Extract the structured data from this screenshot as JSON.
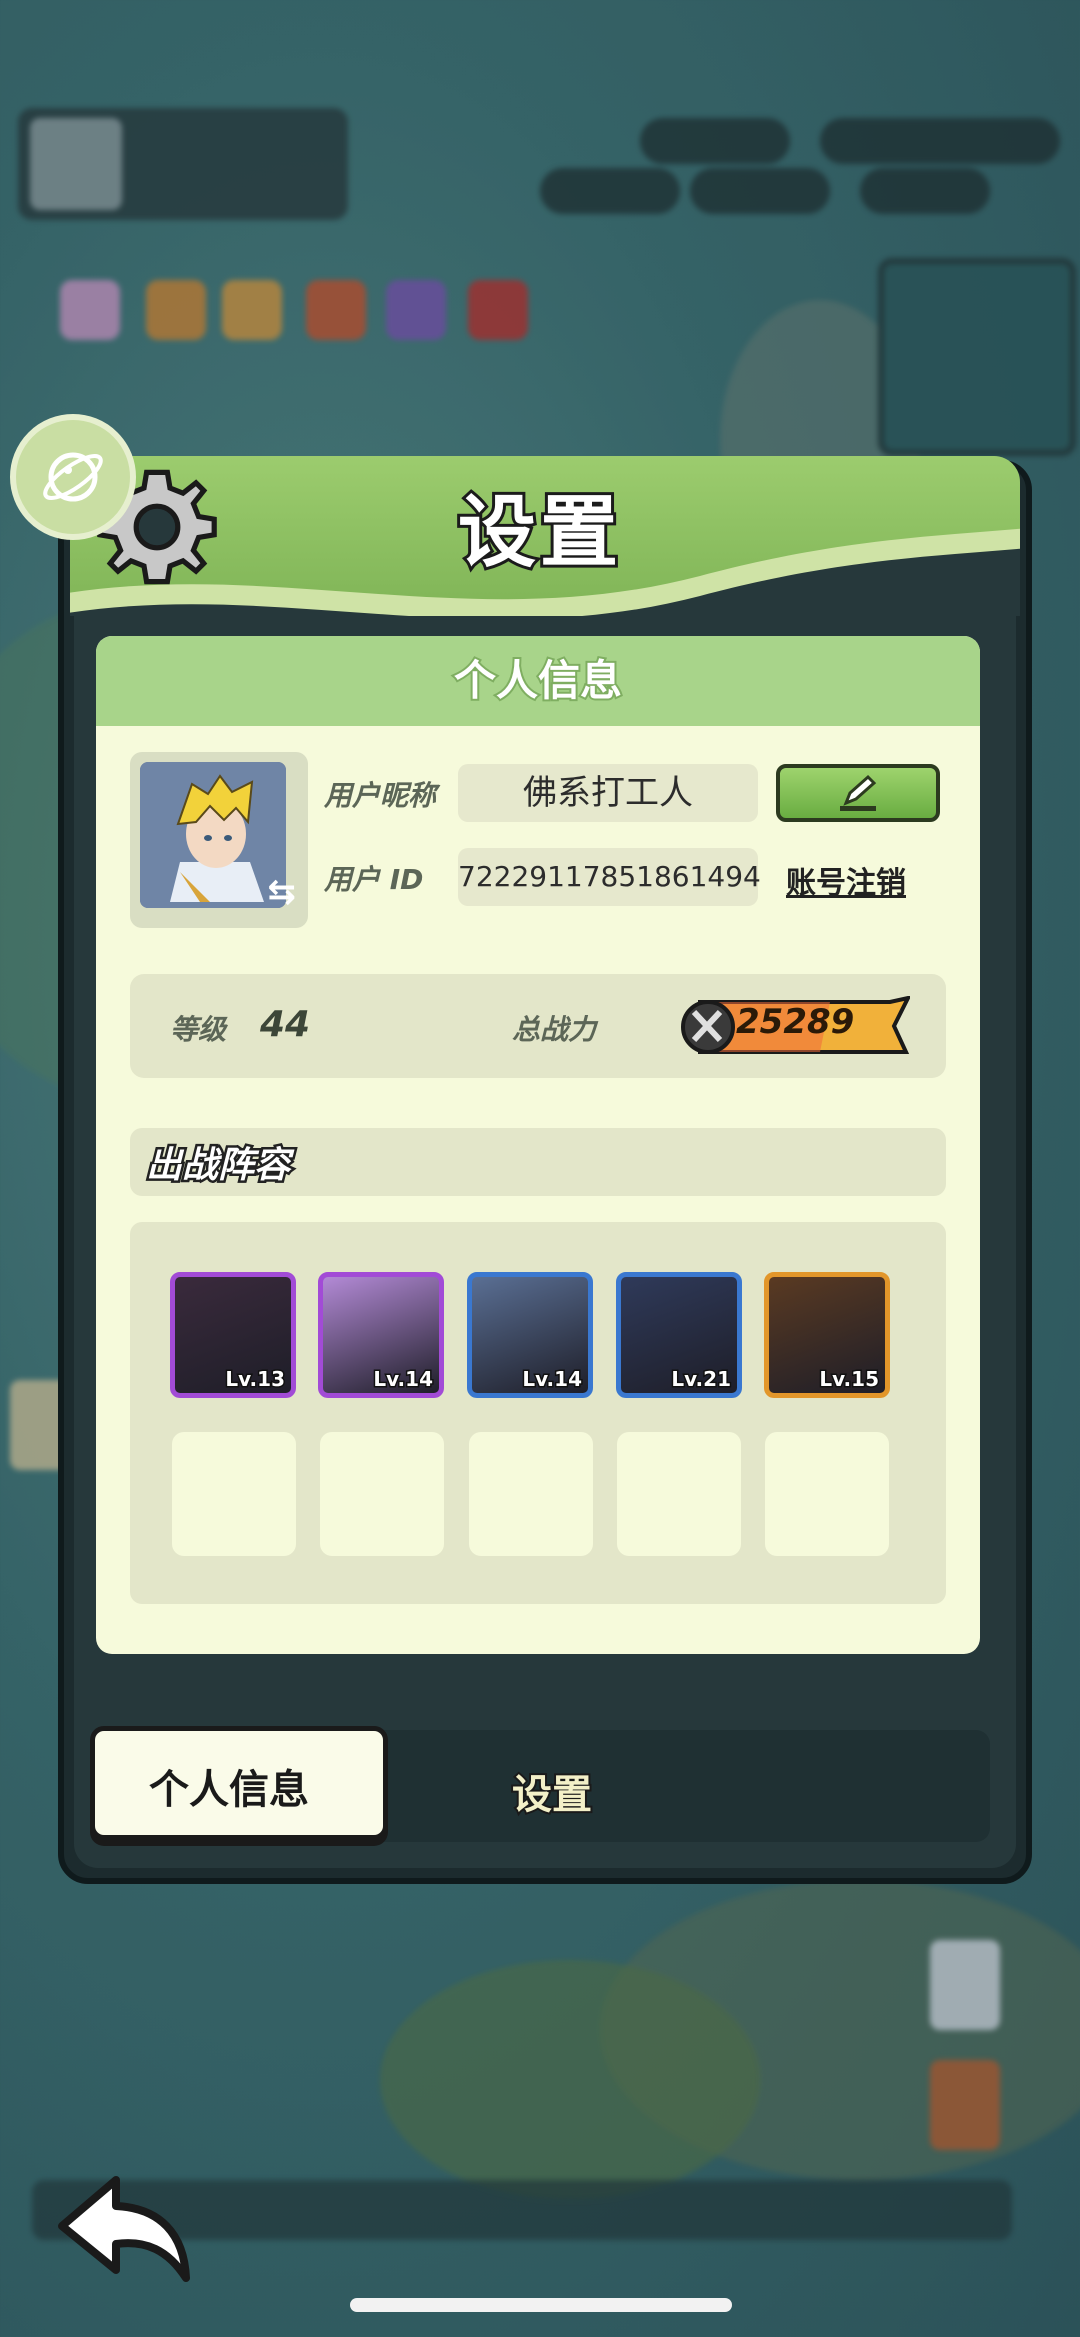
{
  "panel": {
    "title": "设置"
  },
  "profile": {
    "section_title": "个人信息",
    "nickname_label": "用户昵称",
    "nickname_value": "佛系打工人",
    "id_label": "用户  ID",
    "id_value": "72229117851861494",
    "deregister_label": "账号注销",
    "level_label": "等级",
    "level_value": "44",
    "power_label": "总战力",
    "power_value": "25289"
  },
  "lineup": {
    "title": "出战阵容",
    "heroes": [
      {
        "level": "Lv.13",
        "border": "#a24bd6",
        "bg": "#3a2a3c"
      },
      {
        "level": "Lv.14",
        "border": "#a24bd6",
        "bg": "#b38ad6"
      },
      {
        "level": "Lv.14",
        "border": "#3a78d0",
        "bg": "#5a6f94"
      },
      {
        "level": "Lv.21",
        "border": "#3a78d0",
        "bg": "#2f3a5a"
      },
      {
        "level": "Lv.15",
        "border": "#e2962a",
        "bg": "#5a3a22"
      }
    ],
    "empty_slots": 5
  },
  "tabs": {
    "personal": "个人信息",
    "settings": "设置"
  },
  "colors": {
    "header_green": "#8fc462",
    "card_bg": "#f6fadb",
    "panel_dark": "#1c2b2e"
  }
}
